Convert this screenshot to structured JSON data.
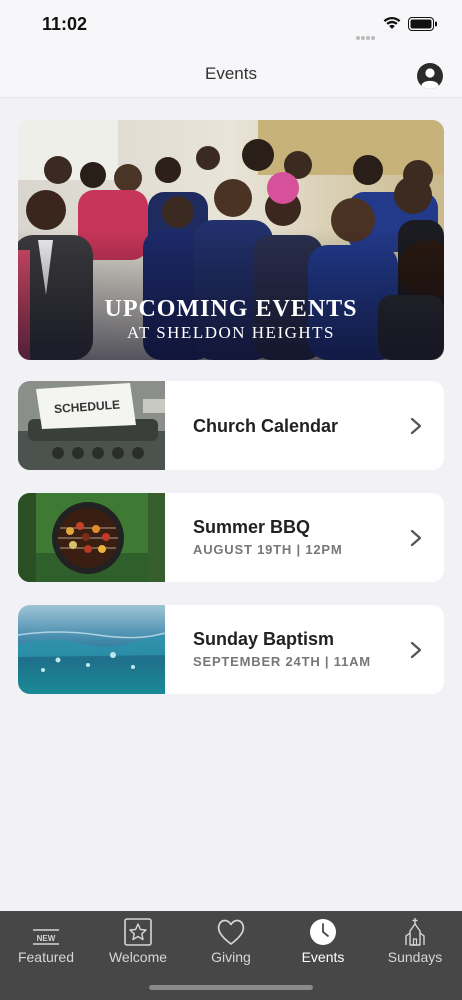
{
  "status_bar": {
    "time": "11:02"
  },
  "header": {
    "title": "Events"
  },
  "hero": {
    "title": "UPCOMING EVENTS",
    "subtitle": "AT SHELDON HEIGHTS"
  },
  "events": [
    {
      "title": "Church Calendar",
      "subtitle": "",
      "thumb_text": "SCHEDULE"
    },
    {
      "title": "Summer BBQ",
      "subtitle": "AUGUST 19TH | 12PM"
    },
    {
      "title": "Sunday Baptism",
      "subtitle": "SEPTEMBER 24TH | 11AM"
    }
  ],
  "tabs": [
    {
      "label": "Featured",
      "icon": "new-badge-icon",
      "badge_text": "NEW"
    },
    {
      "label": "Welcome",
      "icon": "star-icon"
    },
    {
      "label": "Giving",
      "icon": "heart-icon"
    },
    {
      "label": "Events",
      "icon": "clock-icon",
      "active": true
    },
    {
      "label": "Sundays",
      "icon": "church-icon"
    }
  ],
  "colors": {
    "tab_bar": "#474747",
    "background": "#f2f2f6",
    "card": "#ffffff"
  }
}
